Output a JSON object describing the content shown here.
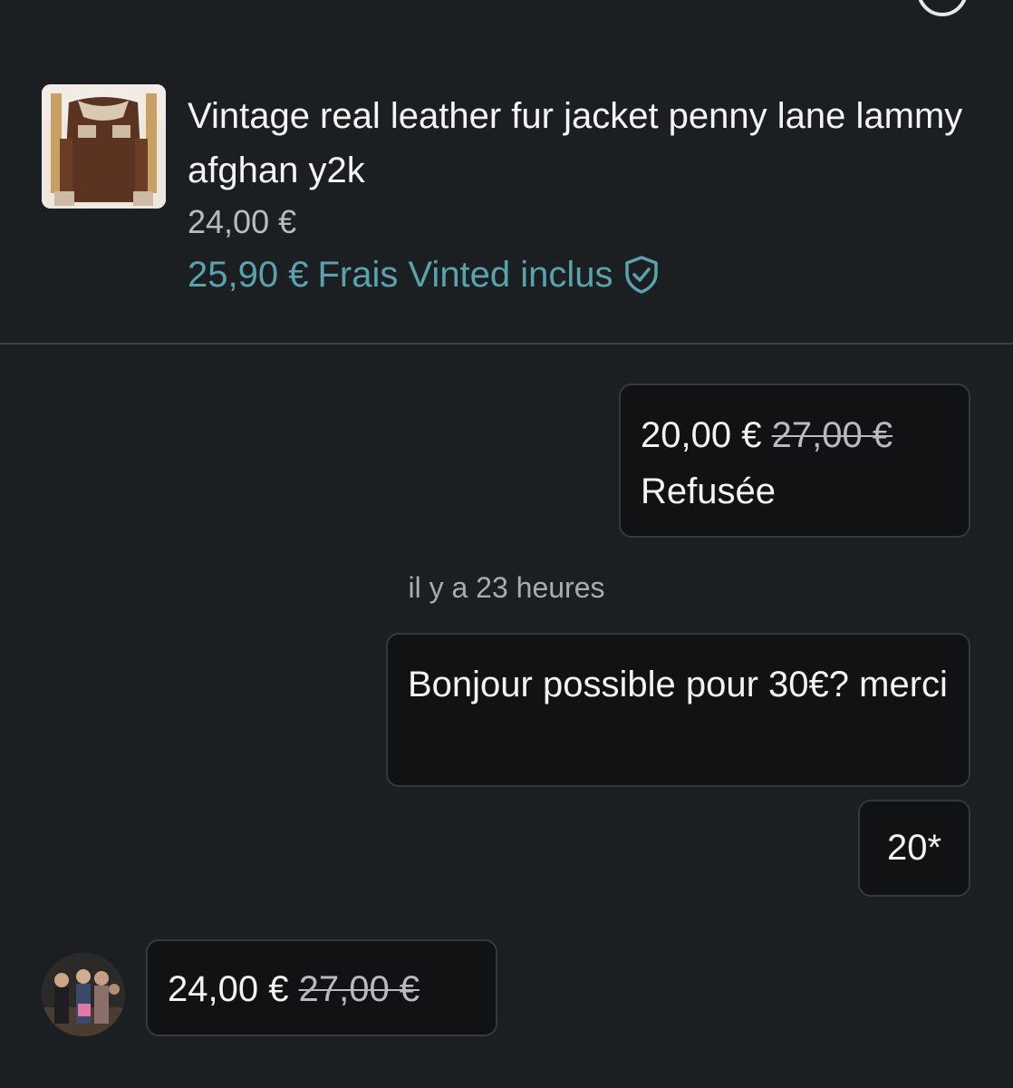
{
  "icons": {
    "back": "chevron-left-icon",
    "top_right": "circle-icon",
    "fee": "shield-check-icon"
  },
  "colors": {
    "background": "#1b1f21",
    "bubble": "#101213",
    "accent": "#5aa3ad",
    "muted": "#b8bcbe"
  },
  "item": {
    "title": "Vintage real leather fur jacket penny lane lammy afghan y2k",
    "price": "24,00 €",
    "fee_price": "25,90 €",
    "fee_label": "Frais Vinted inclus"
  },
  "messages": {
    "offer1": {
      "new_price": "20,00 €",
      "old_price": "27,00 €",
      "status": "Refusée"
    },
    "timestamp": "il y a 23 heures",
    "text1": "Bonjour possible pour 30€? merci",
    "text2": "20*",
    "offer2": {
      "new_price": "24,00 €",
      "old_price": "27,00 €"
    }
  }
}
